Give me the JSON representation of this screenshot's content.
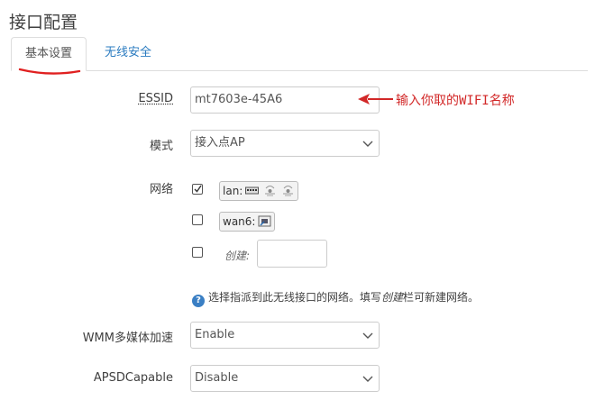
{
  "page_title": "接口配置",
  "tabs": [
    {
      "label": "基本设置",
      "active": true
    },
    {
      "label": "无线安全",
      "active": false
    }
  ],
  "annotation": {
    "text": "输入你取的WIFI名称",
    "color": "#d22828"
  },
  "form": {
    "essid": {
      "label": "ESSID",
      "value": "mt7603e-45A6"
    },
    "mode": {
      "label": "模式",
      "value": "接入点AP"
    },
    "network": {
      "label": "网络",
      "items": [
        {
          "name": "lan:",
          "checked": true,
          "icons": [
            "ethernet-switch-icon",
            "wifi-disabled-icon",
            "wifi-disabled-icon"
          ]
        },
        {
          "name": "wan6:",
          "checked": false,
          "icons": [
            "ethernet-port-icon"
          ]
        },
        {
          "name": "创建:",
          "checked": false,
          "input_value": ""
        }
      ],
      "help_prefix": "选择指派到此无线接口的网络。填写",
      "help_em": "创建",
      "help_suffix": "栏可新建网络。"
    },
    "wmm": {
      "label": "WMM多媒体加速",
      "value": "Enable"
    },
    "apsd": {
      "label": "APSDCapable",
      "value": "Disable"
    }
  },
  "colors": {
    "accent": "#2a7bc0",
    "annotation": "#d22828",
    "border": "#cccccc"
  }
}
